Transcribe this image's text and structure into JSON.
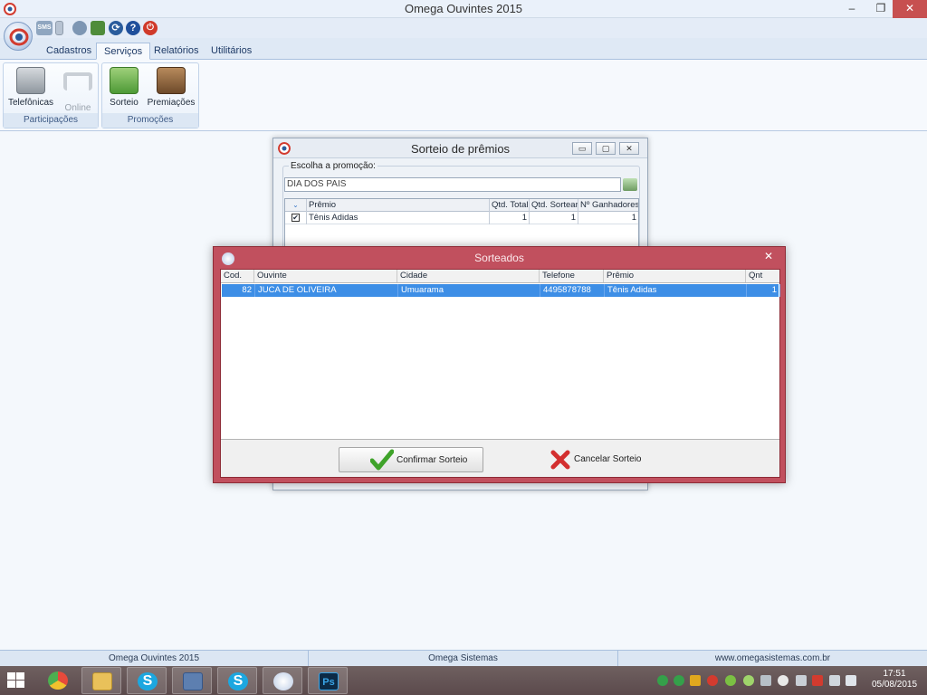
{
  "window": {
    "title": "Omega Ouvintes 2015",
    "minimize": "–",
    "maximize": "❐",
    "close": "✕"
  },
  "quick_access": {
    "sms_label": "SMS",
    "sync_glyph": "⟳",
    "help_glyph": "?",
    "power_glyph": "⏻"
  },
  "ribbon": {
    "tabs": [
      "Cadastros",
      "Serviços",
      "Relatórios",
      "Utilitários"
    ],
    "active_tab": "Serviços",
    "groups": [
      {
        "label": "Participações",
        "buttons": [
          {
            "label": "Telefônicas",
            "icon": "telephone-icon",
            "enabled": true
          },
          {
            "label": "Online",
            "icon": "headset-icon",
            "enabled": false
          }
        ]
      },
      {
        "label": "Promoções",
        "buttons": [
          {
            "label": "Sorteio",
            "icon": "dice-icon",
            "enabled": true
          },
          {
            "label": "Premiações",
            "icon": "chest-icon",
            "enabled": true
          }
        ]
      }
    ]
  },
  "sorteio_window": {
    "title": "Sorteio de prêmios",
    "buttons": {
      "minimize": "▭",
      "maximize": "▢",
      "close": "✕"
    },
    "group_label": "Escolha a promoção:",
    "promotion_value": "DIA DOS PAIS",
    "grid": {
      "columns": [
        "",
        "Prêmio",
        "Qtd. Total",
        "Qtd. Sortear",
        "Nº Ganhadores"
      ],
      "header_glyph": "⌄",
      "rows": [
        {
          "checked": "✔",
          "premio": "Tênis Adidas",
          "qtd_total": "1",
          "qtd_sortear": "1",
          "ganhadores": "1"
        }
      ]
    }
  },
  "dialog": {
    "title": "Sorteados",
    "close_glyph": "✕",
    "columns": [
      "Cod.",
      "Ouvinte",
      "Cidade",
      "Telefone",
      "Prêmio",
      "Qnt"
    ],
    "rows": [
      {
        "cod": "82",
        "ouvinte": "JUCA DE OLIVEIRA",
        "cidade": "Umuarama",
        "telefone": "4495878788",
        "premio": "Tênis Adidas",
        "qnt": "1"
      }
    ],
    "confirm_label": "Confirmar Sorteio",
    "cancel_label": "Cancelar Sorteio"
  },
  "statusbar": [
    "Omega Ouvintes 2015",
    "Omega Sistemas",
    "www.omegasistemas.com.br"
  ],
  "taskbar": {
    "apps": [
      "chrome",
      "file-explorer",
      "skype",
      "virtualbox",
      "skype",
      "omega-ouvintes",
      "photoshop"
    ],
    "skype_glyph": "S",
    "ps_glyph": "Ps",
    "clock_time": "17:51",
    "clock_date": "05/08/2015"
  },
  "colors": {
    "dialog_frame": "#c1505e",
    "selection": "#3d8ee6",
    "accent": "#1f4f9b"
  }
}
